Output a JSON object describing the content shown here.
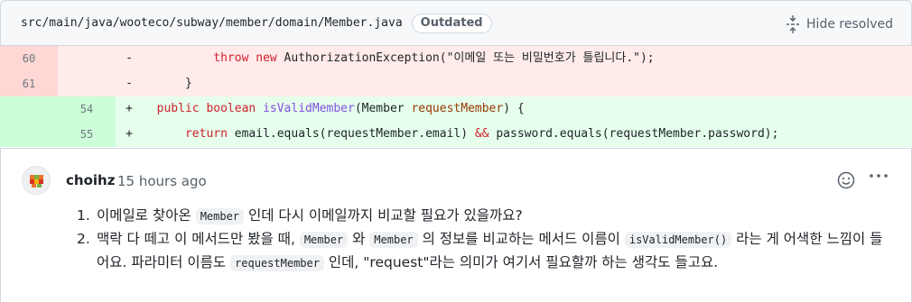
{
  "file": {
    "path": "src/main/java/wooteco/subway/member/domain/Member.java",
    "badge": "Outdated",
    "hide_resolved_label": "Hide resolved"
  },
  "diff": {
    "rows": [
      {
        "type": "del",
        "old": "60",
        "new": "",
        "sign": "-",
        "indent": "          ",
        "tokens": [
          [
            "kw",
            "throw"
          ],
          [
            "t",
            " "
          ],
          [
            "kw",
            "new"
          ],
          [
            "t",
            " AuthorizationException(\"이메일 또는 비밀번호가 틀립니다.\");"
          ]
        ]
      },
      {
        "type": "del",
        "old": "61",
        "new": "",
        "sign": "-",
        "indent": "      ",
        "tokens": [
          [
            "t",
            "}"
          ]
        ]
      },
      {
        "type": "add",
        "old": "",
        "new": "54",
        "sign": "+",
        "indent": "  ",
        "tokens": [
          [
            "kw",
            "public"
          ],
          [
            "t",
            " "
          ],
          [
            "kw",
            "boolean"
          ],
          [
            "t",
            " "
          ],
          [
            "fn",
            "isValidMember"
          ],
          [
            "t",
            "(Member "
          ],
          [
            "param",
            "requestMember"
          ],
          [
            "t",
            ") {"
          ]
        ]
      },
      {
        "type": "add",
        "old": "",
        "new": "55",
        "sign": "+",
        "indent": "      ",
        "tokens": [
          [
            "kw",
            "return"
          ],
          [
            "t",
            " email.equals(requestMember.email) "
          ],
          [
            "kw",
            "&&"
          ],
          [
            "t",
            " password.equals(requestMember.password);"
          ]
        ]
      }
    ]
  },
  "comment": {
    "author": "choihz",
    "timestamp": "15 hours ago",
    "items": [
      {
        "num": "1.",
        "parts": [
          [
            "t",
            "이메일로 찾아온 "
          ],
          [
            "c",
            "Member"
          ],
          [
            "t",
            " 인데 다시 이메일까지 비교할 필요가 있을까요?"
          ]
        ]
      },
      {
        "num": "2.",
        "parts": [
          [
            "t",
            "맥락 다 떼고 이 메서드만 봤을 때, "
          ],
          [
            "c",
            "Member"
          ],
          [
            "t",
            " 와 "
          ],
          [
            "c",
            "Member"
          ],
          [
            "t",
            " 의 정보를 비교하는 메서드 이름이 "
          ],
          [
            "c",
            "isValidMember()"
          ],
          [
            "t",
            " 라는 게 어색한 느낌이 들어요. 파라미터 이름도 "
          ],
          [
            "c",
            "requestMember"
          ],
          [
            "t",
            " 인데, \"request\"라는 의미가 여기서 필요할까 하는 생각도 들고요."
          ]
        ]
      }
    ]
  },
  "colors": {
    "del_bg": "#ffebe9",
    "add_bg": "#e6ffec",
    "keyword": "#cf222e",
    "function": "#8250df",
    "parameter": "#953800"
  },
  "icons": [
    "unfold-icon",
    "smiley-icon",
    "kebab-horizontal-icon",
    "avatar"
  ]
}
